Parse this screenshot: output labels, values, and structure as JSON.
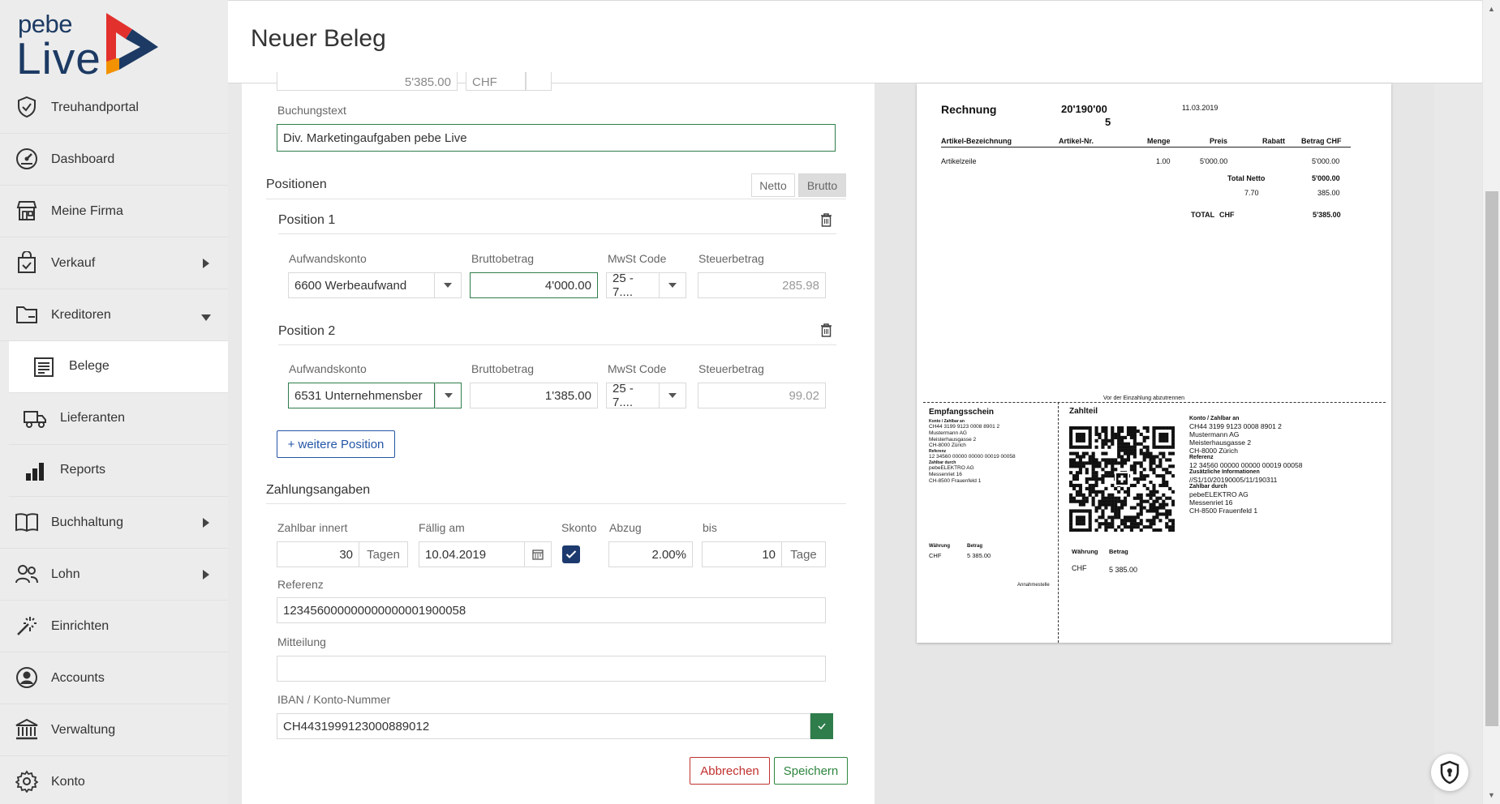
{
  "app": {
    "logo_top": "pebe",
    "logo_bottom": "Live",
    "accent": "#1c3a63",
    "logo_red": "#e2312d",
    "logo_orange": "#f39200"
  },
  "sidebar": {
    "items": [
      {
        "label": "Treuhandportal",
        "icon": "shield-check-icon"
      },
      {
        "label": "Dashboard",
        "icon": "gauge-icon"
      },
      {
        "label": "Meine Firma",
        "icon": "store-icon"
      },
      {
        "label": "Verkauf",
        "icon": "shopping-bag-icon"
      },
      {
        "label": "Kreditoren",
        "icon": "folder-icon"
      },
      {
        "label": "Buchhaltung",
        "icon": "book-icon"
      },
      {
        "label": "Lohn",
        "icon": "users-icon"
      },
      {
        "label": "Einrichten",
        "icon": "magic-wand-icon"
      },
      {
        "label": "Accounts",
        "icon": "user-circle-icon"
      },
      {
        "label": "Verwaltung",
        "icon": "bank-icon"
      },
      {
        "label": "Konto",
        "icon": "gear-icon"
      }
    ],
    "subitems": [
      {
        "label": "Belege",
        "icon": "receipt-icon"
      },
      {
        "label": "Lieferanten",
        "icon": "truck-icon"
      },
      {
        "label": "Reports",
        "icon": "bar-chart-icon"
      }
    ]
  },
  "header": {
    "title": "Neuer Beleg"
  },
  "form": {
    "top_partial_amount": "5'385.00",
    "top_partial_currency": "CHF",
    "booking_text_label": "Buchungstext",
    "booking_text_value": "Div. Marketingaufgaben pebe Live",
    "positions_title": "Positionen",
    "toggle_netto": "Netto",
    "toggle_brutto": "Brutto",
    "col_account": "Aufwandskonto",
    "col_gross": "Bruttobetrag",
    "col_vat": "MwSt Code",
    "col_tax": "Steuerbetrag",
    "positions": [
      {
        "title": "Position 1",
        "account": "6600 Werbeaufwand",
        "gross": "4'000.00",
        "vat": "25 - 7....",
        "tax": "285.98"
      },
      {
        "title": "Position 2",
        "account": "6531 Unternehmensber",
        "gross": "1'385.00",
        "vat": "25 - 7....",
        "tax": "99.02"
      }
    ],
    "add_position": "+ weitere Position",
    "payment_title": "Zahlungsangaben",
    "pay_within_label": "Zahlbar innert",
    "pay_within_value": "30",
    "pay_within_unit": "Tagen",
    "due_label": "Fällig am",
    "due_value": "10.04.2019",
    "skonto_label": "Skonto",
    "deduction_label": "Abzug",
    "deduction_value": "2.00%",
    "until_label": "bis",
    "until_value": "10",
    "until_unit": "Tage",
    "reference_label": "Referenz",
    "reference_value": "123456000000000000001900058",
    "message_label": "Mitteilung",
    "message_value": "",
    "iban_label": "IBAN / Konto-Nummer",
    "iban_value": "CH4431999123000889012",
    "cancel": "Abbrechen",
    "save": "Speichern"
  },
  "invoice": {
    "title": "Rechnung",
    "number_line1": "20'190'00",
    "number_line2": "5",
    "date": "11.03.2019",
    "headers": [
      "Artikel-Bezeichnung",
      "Artikel-Nr.",
      "Menge",
      "Preis",
      "Rabatt",
      "Betrag CHF"
    ],
    "row": {
      "desc": "Artikelzeile",
      "qty": "1.00",
      "price": "5'000.00",
      "amount": "5'000.00"
    },
    "total_netto_label": "Total Netto",
    "total_netto_value": "5'000.00",
    "vat_rate": "7.70",
    "vat_value": "385.00",
    "total_label": "TOTAL",
    "total_currency": "CHF",
    "total_value": "5'385.00",
    "cut_label": "Vor der Einzahlung abzutrennen",
    "receipt_title": "Empfangsschein",
    "receipt_lines": [
      {
        "t": "Konto / Zahlbar an",
        "b": true
      },
      {
        "t": "CH44 3199 9123 0008 8901 2"
      },
      {
        "t": "Mustermann AG"
      },
      {
        "t": "Meisterhausgasse 2"
      },
      {
        "t": "CH-8000 Zürich"
      },
      {
        "t": "Referenz",
        "b": true
      },
      {
        "t": "12 34560 00000 00000 00019 00058"
      },
      {
        "t": "Zahlbar durch",
        "b": true
      },
      {
        "t": "pebeELEKTRO AG"
      },
      {
        "t": "Messenriet 16"
      },
      {
        "t": "CH-8500 Frauenfeld 1"
      }
    ],
    "receipt_currency_label": "Währung",
    "receipt_amount_label": "Betrag",
    "receipt_currency": "CHF",
    "receipt_amount": "5 385.00",
    "receipt_acceptance": "Annahmestelle",
    "payment_part_title": "Zahlteil",
    "payment_lines": [
      {
        "t": "Konto / Zahlbar an",
        "b": true
      },
      {
        "t": "CH44 3199 9123 0008 8901 2"
      },
      {
        "t": "Mustermann AG"
      },
      {
        "t": "Meisterhausgasse 2"
      },
      {
        "t": "CH-8000 Zürich"
      },
      {
        "t": "Referenz",
        "b": true
      },
      {
        "t": "12 34560 00000 00000 00019 00058"
      },
      {
        "t": "Zusätzliche Informationen",
        "b": true
      },
      {
        "t": "//S1/10/20190005/11/190311"
      },
      {
        "t": "Zahlbar durch",
        "b": true
      },
      {
        "t": "pebeELEKTRO AG"
      },
      {
        "t": "Messenriet 16"
      },
      {
        "t": "CH-8500 Frauenfeld 1"
      }
    ],
    "payment_currency_label": "Währung",
    "payment_amount_label": "Betrag",
    "payment_currency": "CHF",
    "payment_amount": "5 385.00"
  }
}
